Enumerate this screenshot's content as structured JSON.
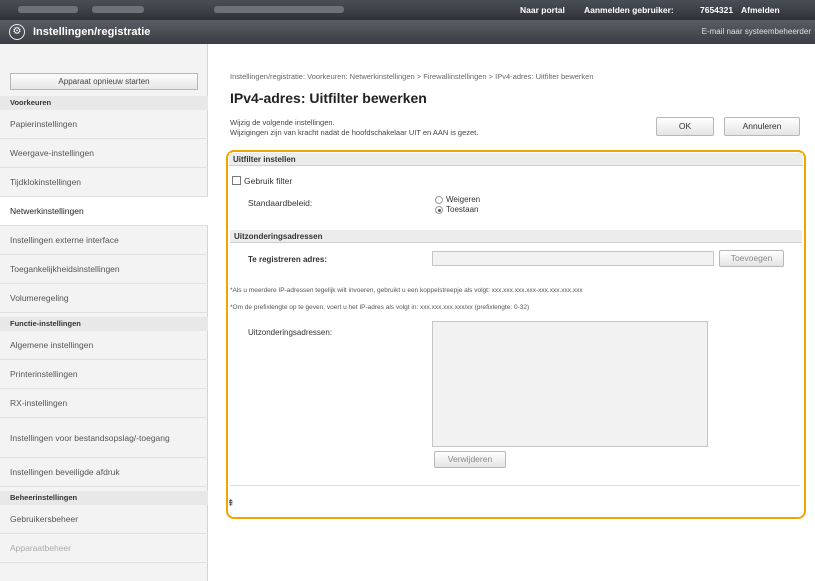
{
  "topbar": {
    "portal_link": "Naar portal",
    "login_user_label": "Aanmelden gebruiker:",
    "user_id": "7654321",
    "logout_link": "Afmelden"
  },
  "header": {
    "title": "Instellingen/registratie",
    "email_link": "E-mail naar systeembeheerder"
  },
  "sidebar": {
    "restart_button": "Apparaat opnieuw starten",
    "sections": {
      "preferences": "Voorkeuren",
      "function_settings": "Functie-instellingen",
      "management": "Beheerinstellingen"
    },
    "preferences_items": [
      "Papierinstellingen",
      "Weergave-instellingen",
      "Tijdklokinstellingen",
      "Netwerkinstellingen",
      "Instellingen externe interface",
      "Toegankelijkheidsinstellingen",
      "Volumeregeling"
    ],
    "function_items": [
      "Algemene instellingen",
      "Printerinstellingen",
      "RX-instellingen",
      "Instellingen voor bestandsopslag/-toegang",
      "Instellingen beveiligde afdruk"
    ],
    "management_items": [
      "Gebruikersbeheer",
      "Apparaatbeheer"
    ]
  },
  "main": {
    "breadcrumb": "Instellingen/registratie: Voorkeuren: Netwerkinstellingen > Firewallinstellingen > IPv4-adres: Uitfilter bewerken",
    "title": "IPv4-adres: Uitfilter bewerken",
    "instruction_1": "Wijzig de volgende instellingen.",
    "instruction_2": "Wijzigingen zijn van kracht nadat de hoofdschakelaar UIT en AAN is gezet.",
    "ok_button": "OK",
    "cancel_button": "Annuleren",
    "filter_section": {
      "heading": "Uitfilter instellen",
      "use_filter_label": "Gebruik filter",
      "use_filter_checked": false,
      "default_policy_label": "Standaardbeleid:",
      "policy_options": [
        "Weigeren",
        "Toestaan"
      ],
      "policy_selected": "Toestaan"
    },
    "exception_section": {
      "heading": "Uitzonderingsadressen",
      "register_label": "Te registreren adres:",
      "register_value": "",
      "add_button": "Toevoegen",
      "note_1": "*Als u meerdere IP-adressen tegelijk wilt invoeren, gebruikt u een koppelstreepje als volgt: xxx.xxx.xxx.xxx-xxx.xxx.xxx.xxx",
      "note_2": "*Om de prefixlengte op te geven, voert u het IP-adres als volgt in: xxx.xxx.xxx.xxx/xx (prefixlengte: 0-32)",
      "list_label": "Uitzonderingsadressen:",
      "delete_button": "Verwijderen"
    },
    "back_to_top_glyph": "⇞"
  },
  "colors": {
    "highlight_border": "#f0a500",
    "header_bg": "#3a3d42"
  }
}
